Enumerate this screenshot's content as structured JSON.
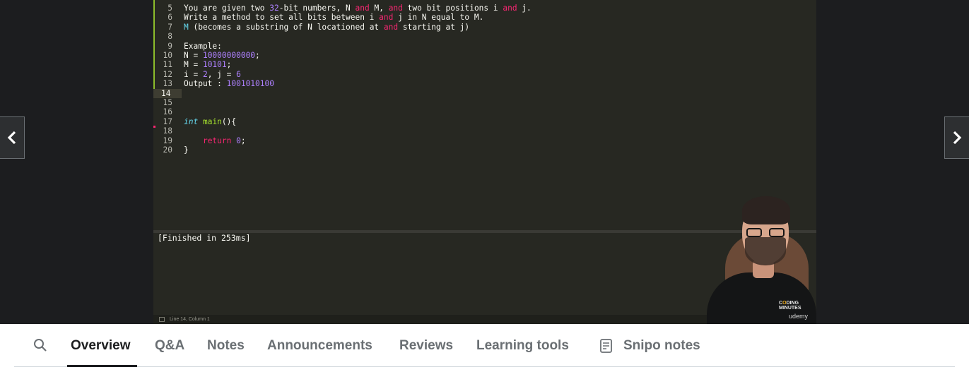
{
  "editor": {
    "lines": [
      {
        "n": "5",
        "parts": [
          {
            "t": "You are given two "
          },
          {
            "t": "32",
            "c": "num"
          },
          {
            "t": "-bit numbers, N "
          },
          {
            "t": "and",
            "c": "kw"
          },
          {
            "t": " M, "
          },
          {
            "t": "and",
            "c": "kw"
          },
          {
            "t": " two bit positions i "
          },
          {
            "t": "and",
            "c": "kw"
          },
          {
            "t": " j."
          }
        ]
      },
      {
        "n": "6",
        "parts": [
          {
            "t": "Write a method to set all bits between i "
          },
          {
            "t": "and",
            "c": "kw"
          },
          {
            "t": " j in N equal to M."
          }
        ]
      },
      {
        "n": "7",
        "parts": [
          {
            "t": "M",
            "c": "cyan"
          },
          {
            "t": " (becomes a substring of N locationed at "
          },
          {
            "t": "and",
            "c": "kw"
          },
          {
            "t": " starting at j)"
          }
        ]
      },
      {
        "n": "8",
        "parts": []
      },
      {
        "n": "9",
        "parts": [
          {
            "t": "Example:"
          }
        ]
      },
      {
        "n": "10",
        "parts": [
          {
            "t": "N = "
          },
          {
            "t": "10000000000",
            "c": "num"
          },
          {
            "t": ";"
          }
        ]
      },
      {
        "n": "11",
        "parts": [
          {
            "t": "M = "
          },
          {
            "t": "10101",
            "c": "num"
          },
          {
            "t": ";"
          }
        ]
      },
      {
        "n": "12",
        "parts": [
          {
            "t": "i = "
          },
          {
            "t": "2",
            "c": "num"
          },
          {
            "t": ", j = "
          },
          {
            "t": "6",
            "c": "num"
          }
        ]
      },
      {
        "n": "13",
        "parts": [
          {
            "t": "Output : "
          },
          {
            "t": "1001010100",
            "c": "num"
          }
        ]
      },
      {
        "n": "14",
        "parts": [],
        "current": true
      },
      {
        "n": "15",
        "parts": []
      },
      {
        "n": "16",
        "parts": []
      },
      {
        "n": "17",
        "parts": [
          {
            "t": "int",
            "c": "type"
          },
          {
            "t": " "
          },
          {
            "t": "main",
            "c": "fn"
          },
          {
            "t": "(){"
          }
        ]
      },
      {
        "n": "18",
        "parts": []
      },
      {
        "n": "19",
        "parts": [
          {
            "t": "    "
          },
          {
            "t": "return",
            "c": "kw"
          },
          {
            "t": " "
          },
          {
            "t": "0",
            "c": "num"
          },
          {
            "t": ";"
          }
        ]
      },
      {
        "n": "20",
        "parts": [
          {
            "t": "}"
          }
        ]
      }
    ],
    "output_text": "[Finished in 253ms]",
    "status_text": "Line 14, Column 1"
  },
  "branding": {
    "logo_text": "CODING MINUTES",
    "platform": "udemy"
  },
  "navigation": {
    "prev_icon": "chevron-left-icon",
    "next_icon": "chevron-right-icon"
  },
  "tabs": {
    "search_icon": "search-icon",
    "items": [
      "Overview",
      "Q&A",
      "Notes",
      "Announcements",
      "Reviews",
      "Learning tools",
      "Snipo notes"
    ],
    "active": "Overview"
  },
  "colors": {
    "editor_bg": "#272822",
    "keyword": "#f92672",
    "number": "#ae81ff",
    "type": "#66d9ef",
    "function": "#a6e22e",
    "player_bg": "#1c1d1f",
    "tab_active": "#1c1d1f",
    "tab_inactive": "#6a6f73"
  }
}
